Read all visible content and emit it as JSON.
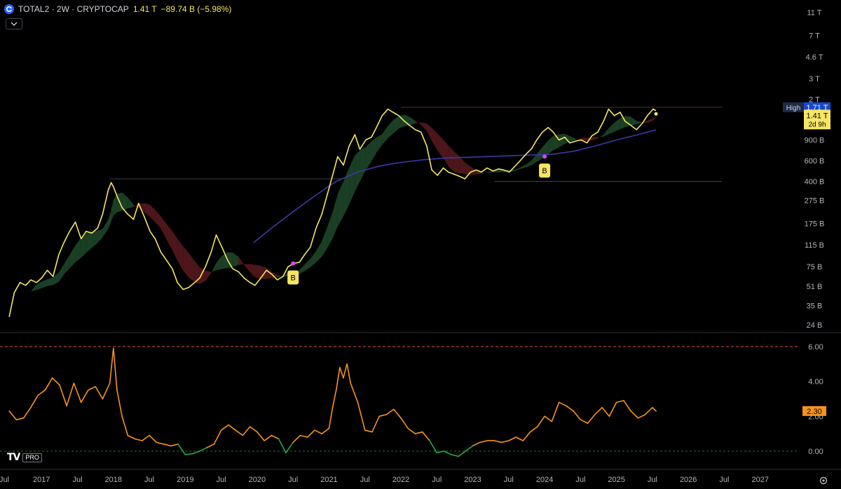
{
  "header": {
    "symbol": "TOTAL2 · 2W · CRYPTOCAP",
    "value": "1.41 T",
    "change": "−89.74 B (−5.98%)"
  },
  "icons": {
    "logo": "cryptocap-logo-icon",
    "collapse": "chevron-down-icon",
    "settings": "gear-icon",
    "brand": "tradingview-logo-icon"
  },
  "brand": {
    "mark": "TV",
    "badge": "PRO"
  },
  "colors": {
    "price_line": "#f5e663",
    "ribbon_bull": "#1f4a2c",
    "ribbon_bear": "#5a1a1f",
    "ma_line": "#3a3aa8",
    "oscillator": "#f7931a",
    "oscillator_low": "#22ab4a",
    "threshold_line": "#e0533d",
    "zero_line": "#22ab4a",
    "high_label_bg": "#1e2a4a",
    "current_label_bg": "#f5e663",
    "osc_label_bg": "#f7931a"
  },
  "price_axis": {
    "ticks": [
      "11 T",
      "7 T",
      "4.6 T",
      "3 T",
      "2 T",
      "1.3 T",
      "900 B",
      "600 B",
      "400 B",
      "275 B",
      "175 B",
      "115 B",
      "75 B",
      "51 B",
      "35 B",
      "24 B"
    ]
  },
  "high_label": {
    "text": "High",
    "value": "1.71 T"
  },
  "current_label": {
    "value": "1.41 T",
    "countdown": "2d 9h"
  },
  "osc_axis": {
    "ticks": [
      "6.00",
      "4.00",
      "2.00",
      "0.00"
    ]
  },
  "osc_label": {
    "value": "2.30"
  },
  "time_axis": {
    "ticks": [
      "Jul",
      "2017",
      "Jul",
      "2018",
      "Jul",
      "2019",
      "Jul",
      "2020",
      "Jul",
      "2021",
      "Jul",
      "2022",
      "Jul",
      "2023",
      "Jul",
      "2024",
      "Jul",
      "2025",
      "Jul",
      "2026",
      "Jul",
      "2027"
    ]
  },
  "buy_markers": [
    "B",
    "B"
  ],
  "chart_data": [
    {
      "type": "line",
      "scale": "log",
      "series": [
        {
          "values_t": [
            2016.55,
            2016.62,
            2016.7,
            2016.78,
            2016.85,
            2016.93,
            2017.0,
            2017.08,
            2017.16,
            2017.24,
            2017.31,
            2017.39,
            2017.47,
            2017.55,
            2017.62,
            2017.7,
            2017.78,
            2017.85,
            2017.93,
            2017.97,
            2018.0,
            2018.05,
            2018.12,
            2018.2,
            2018.28,
            2018.35,
            2018.43,
            2018.51,
            2018.58,
            2018.66,
            2018.74,
            2018.82,
            2018.89,
            2018.97,
            2019.05,
            2019.13,
            2019.2,
            2019.28,
            2019.36,
            2019.43,
            2019.51,
            2019.59,
            2019.66,
            2019.74,
            2019.82,
            2019.9,
            2019.97,
            2020.05,
            2020.13,
            2020.2,
            2020.28,
            2020.36,
            2020.43,
            2020.51,
            2020.59,
            2020.66,
            2020.74,
            2020.82,
            2020.9,
            2020.97,
            2021.05,
            2021.12,
            2021.2,
            2021.28,
            2021.36,
            2021.43,
            2021.51,
            2021.59,
            2021.66,
            2021.74,
            2021.82,
            2021.89,
            2021.97,
            2022.05,
            2022.12,
            2022.2,
            2022.28,
            2022.36,
            2022.43,
            2022.51,
            2022.59,
            2022.66,
            2022.74,
            2022.82,
            2022.89,
            2022.97,
            2023.05,
            2023.12,
            2023.2,
            2023.28,
            2023.36,
            2023.43,
            2023.51,
            2023.59,
            2023.66,
            2023.74,
            2023.82,
            2023.89,
            2023.97,
            2024.05,
            2024.12,
            2024.2,
            2024.28,
            2024.35,
            2024.43,
            2024.51,
            2024.59,
            2024.66,
            2024.74,
            2024.82,
            2024.89,
            2024.97,
            2025.05,
            2025.12,
            2025.2,
            2025.28,
            2025.36,
            2025.43,
            2025.51,
            2025.55
          ],
          "values": [
            0.028,
            0.045,
            0.055,
            0.052,
            0.058,
            0.055,
            0.06,
            0.07,
            0.062,
            0.095,
            0.12,
            0.15,
            0.18,
            0.13,
            0.15,
            0.145,
            0.16,
            0.21,
            0.34,
            0.39,
            0.36,
            0.3,
            0.24,
            0.21,
            0.19,
            0.26,
            0.2,
            0.15,
            0.13,
            0.1,
            0.085,
            0.072,
            0.055,
            0.048,
            0.05,
            0.055,
            0.06,
            0.075,
            0.1,
            0.14,
            0.11,
            0.085,
            0.072,
            0.068,
            0.06,
            0.055,
            0.052,
            0.06,
            0.07,
            0.065,
            0.058,
            0.062,
            0.075,
            0.08,
            0.082,
            0.095,
            0.11,
            0.16,
            0.21,
            0.3,
            0.45,
            0.65,
            0.55,
            0.8,
            1.0,
            0.75,
            0.9,
            0.95,
            1.15,
            1.45,
            1.65,
            1.55,
            1.45,
            1.3,
            1.2,
            1.1,
            1.05,
            0.8,
            0.5,
            0.45,
            0.52,
            0.48,
            0.46,
            0.44,
            0.42,
            0.48,
            0.5,
            0.48,
            0.52,
            0.49,
            0.51,
            0.5,
            0.48,
            0.54,
            0.6,
            0.68,
            0.76,
            0.9,
            1.05,
            1.15,
            1.05,
            0.9,
            0.95,
            0.85,
            0.88,
            0.9,
            0.85,
            0.98,
            1.05,
            1.3,
            1.65,
            1.45,
            1.55,
            1.3,
            1.2,
            1.1,
            1.25,
            1.45,
            1.65,
            1.6,
            1.5
          ]
        },
        {
          "values_t": [
            2019.95,
            2020.2,
            2020.5,
            2020.8,
            2021.1,
            2021.4,
            2021.7,
            2022.0,
            2022.3,
            2022.6,
            2022.9,
            2023.2,
            2023.5,
            2023.8,
            2024.1,
            2024.4,
            2024.7,
            2025.0,
            2025.3,
            2025.55
          ],
          "values": [
            0.12,
            0.16,
            0.22,
            0.3,
            0.4,
            0.48,
            0.54,
            0.58,
            0.61,
            0.63,
            0.64,
            0.65,
            0.66,
            0.67,
            0.68,
            0.72,
            0.8,
            0.9,
            1.0,
            1.1
          ]
        }
      ],
      "xlim": [
        2016.5,
        2027.5
      ],
      "ylim": [
        0.024,
        11
      ],
      "reference_lines": [
        1.71,
        0.4
      ],
      "legend": "none"
    },
    {
      "type": "line",
      "series": [
        {
          "values_t": [
            2016.55,
            2016.65,
            2016.75,
            2016.85,
            2016.95,
            2017.05,
            2017.15,
            2017.25,
            2017.35,
            2017.45,
            2017.55,
            2017.65,
            2017.75,
            2017.85,
            2017.95,
            2018.0,
            2018.05,
            2018.12,
            2018.2,
            2018.3,
            2018.4,
            2018.5,
            2018.6,
            2018.7,
            2018.8,
            2018.9,
            2019.0,
            2019.1,
            2019.2,
            2019.3,
            2019.4,
            2019.5,
            2019.6,
            2019.7,
            2019.8,
            2019.9,
            2020.0,
            2020.1,
            2020.2,
            2020.3,
            2020.4,
            2020.5,
            2020.6,
            2020.7,
            2020.8,
            2020.9,
            2021.0,
            2021.05,
            2021.1,
            2021.15,
            2021.2,
            2021.25,
            2021.3,
            2021.4,
            2021.5,
            2021.6,
            2021.7,
            2021.8,
            2021.9,
            2022.0,
            2022.1,
            2022.2,
            2022.3,
            2022.4,
            2022.5,
            2022.6,
            2022.7,
            2022.8,
            2022.9,
            2023.0,
            2023.1,
            2023.2,
            2023.3,
            2023.4,
            2023.5,
            2023.6,
            2023.7,
            2023.8,
            2023.9,
            2024.0,
            2024.1,
            2024.2,
            2024.3,
            2024.4,
            2024.5,
            2024.6,
            2024.7,
            2024.8,
            2024.9,
            2025.0,
            2025.1,
            2025.2,
            2025.3,
            2025.4,
            2025.5,
            2025.55
          ],
          "values": [
            2.3,
            1.8,
            1.9,
            2.5,
            3.2,
            3.5,
            4.2,
            3.8,
            2.6,
            3.9,
            2.8,
            3.5,
            3.7,
            3.0,
            3.9,
            5.9,
            3.5,
            2.0,
            0.9,
            0.7,
            0.6,
            0.9,
            0.5,
            0.4,
            0.3,
            0.4,
            -0.2,
            -0.15,
            0.0,
            0.2,
            0.4,
            1.2,
            1.5,
            1.2,
            0.9,
            1.4,
            1.1,
            0.6,
            0.9,
            0.7,
            -0.1,
            0.5,
            0.9,
            0.8,
            1.2,
            1.0,
            1.3,
            2.5,
            3.5,
            4.8,
            4.2,
            5.0,
            3.9,
            2.8,
            1.2,
            1.1,
            2.0,
            2.1,
            2.4,
            1.9,
            1.3,
            1.0,
            1.1,
            0.6,
            -0.1,
            0.0,
            -0.2,
            -0.3,
            0.0,
            0.3,
            0.5,
            0.6,
            0.6,
            0.5,
            0.6,
            0.8,
            0.6,
            1.1,
            1.4,
            2.0,
            1.7,
            2.8,
            2.6,
            2.3,
            1.8,
            1.6,
            2.1,
            2.5,
            2.0,
            2.8,
            2.9,
            2.3,
            1.9,
            2.1,
            2.5,
            2.3
          ]
        }
      ],
      "xlim": [
        2016.5,
        2027.5
      ],
      "ylim": [
        -0.3,
        7.0
      ],
      "reference_lines": [
        6.0,
        0.0
      ],
      "legend": "none"
    }
  ]
}
